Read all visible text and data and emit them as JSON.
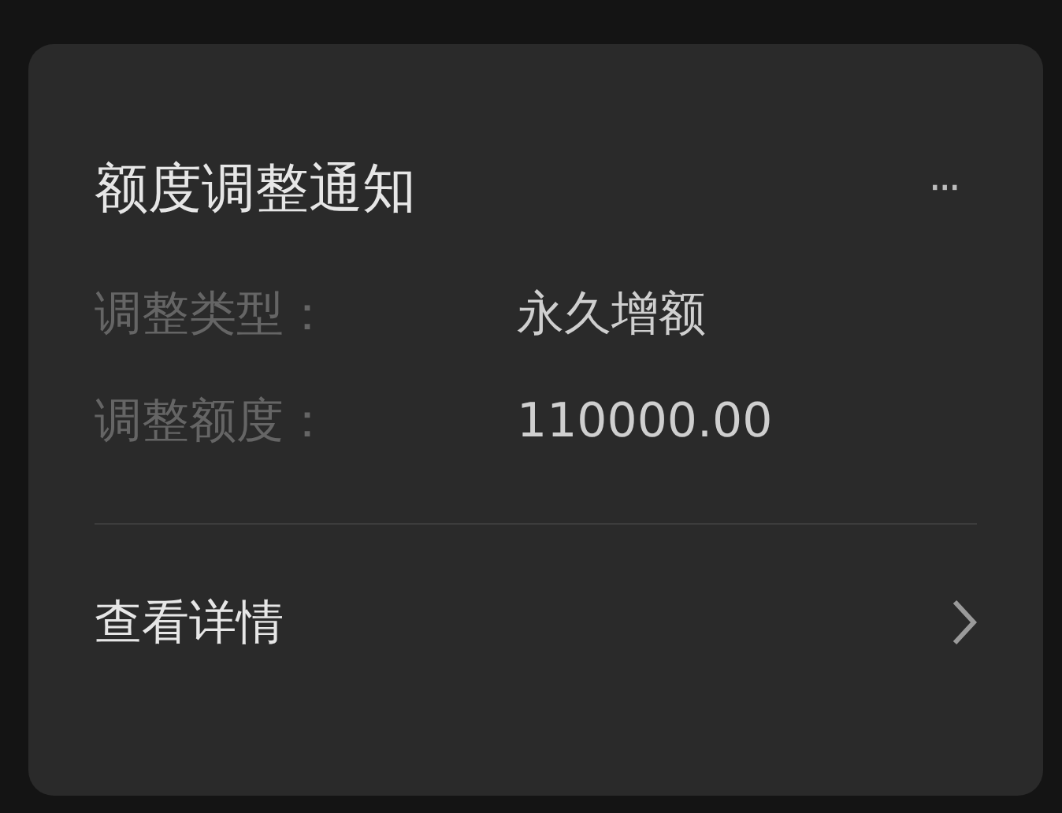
{
  "card": {
    "title": "额度调整通知",
    "menu": "···",
    "fields": [
      {
        "label": "调整类型：",
        "value": "永久增额"
      },
      {
        "label": "调整额度：",
        "value": "110000.00"
      }
    ],
    "link": "查看详情"
  }
}
